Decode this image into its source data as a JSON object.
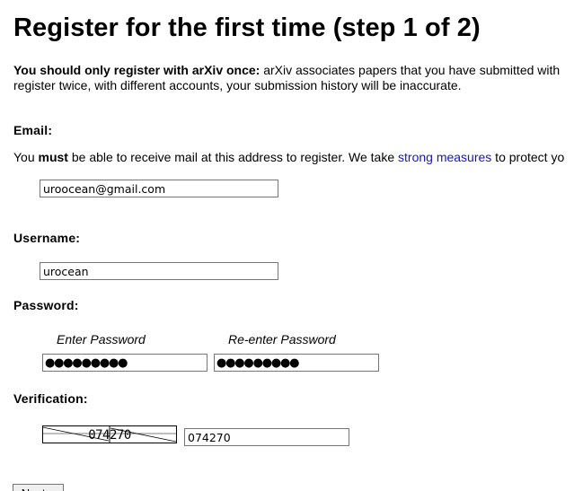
{
  "page": {
    "title": "Register for the first time (step 1 of 2)",
    "intro_bold": "You should only register with arXiv once:",
    "intro_line1_rest": " arXiv associates papers that you have submitted with",
    "intro_line2": "register twice, with different accounts, your submission history will be inaccurate."
  },
  "email": {
    "label": "Email:",
    "note_prefix": "You ",
    "note_must": "must",
    "note_middle": " be able to receive mail at this address to register. We take ",
    "note_link": "strong measures",
    "note_suffix": " to protect yo",
    "value": "uroocean@gmail.com"
  },
  "username": {
    "label": "Username:",
    "value": "urocean"
  },
  "password": {
    "label": "Password:",
    "enter_caption": "Enter Password",
    "reenter_caption": "Re-enter Password",
    "enter_masked": "●●●●●●●●●",
    "reenter_masked": "●●●●●●●●●"
  },
  "verification": {
    "label": "Verification:",
    "captcha_text": "074270",
    "value": "074270"
  },
  "buttons": {
    "next_label": "Next »"
  },
  "colors": {
    "link": "#1515c8",
    "input_border": "#767676",
    "button_bg": "#efefef"
  }
}
